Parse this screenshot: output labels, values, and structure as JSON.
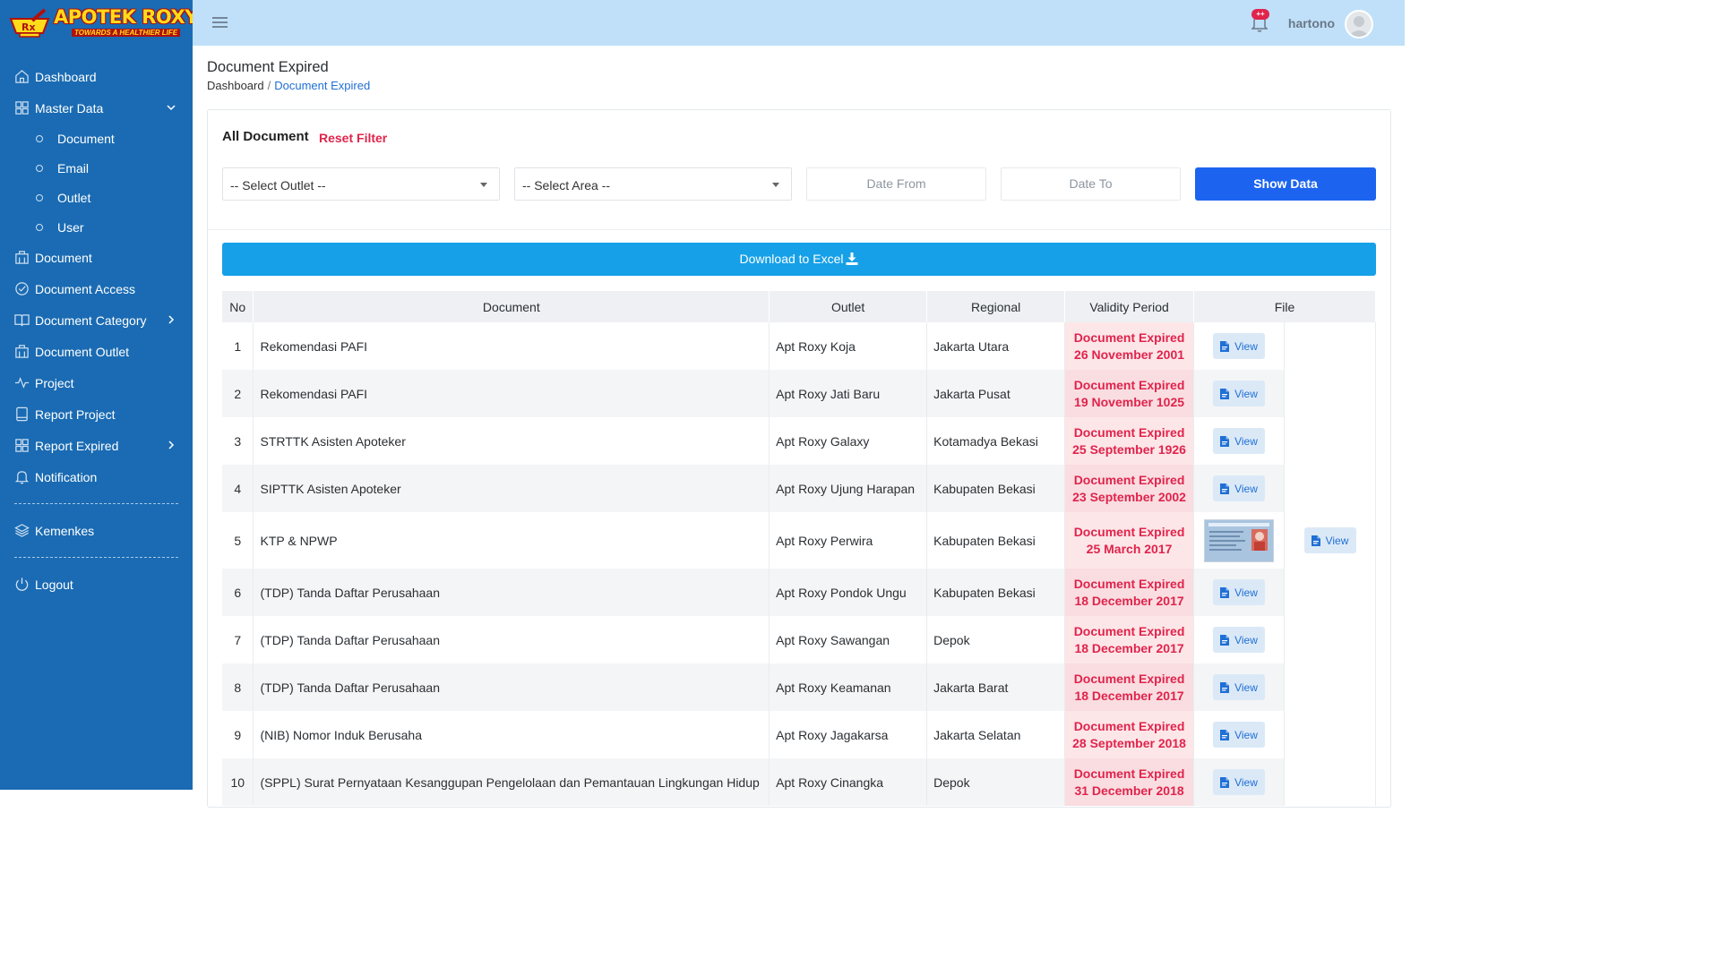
{
  "brand": {
    "name": "APOTEK ROXY",
    "tagline": "TOWARDS A HEALTHIER LIFE"
  },
  "sidebar": {
    "items": [
      {
        "label": "Dashboard",
        "icon": "home-icon"
      },
      {
        "label": "Master Data",
        "icon": "grid-icon",
        "expanded": true,
        "children": [
          {
            "label": "Document"
          },
          {
            "label": "Email"
          },
          {
            "label": "Outlet"
          },
          {
            "label": "User"
          }
        ]
      },
      {
        "label": "Document",
        "icon": "building-icon"
      },
      {
        "label": "Document Access",
        "icon": "check-circle-icon"
      },
      {
        "label": "Document Category",
        "icon": "book-icon",
        "has_children": true
      },
      {
        "label": "Document Outlet",
        "icon": "building-icon"
      },
      {
        "label": "Project",
        "icon": "activity-icon"
      },
      {
        "label": "Report Project",
        "icon": "tablet-icon"
      },
      {
        "label": "Report Expired",
        "icon": "grid-icon",
        "has_children": true
      },
      {
        "label": "Notification",
        "icon": "bell-icon"
      },
      {
        "label": "Kemenkes",
        "icon": "layers-icon"
      },
      {
        "label": "Logout",
        "icon": "power-icon"
      }
    ]
  },
  "topbar": {
    "username": "hartono",
    "notification_badge": "++"
  },
  "page": {
    "title": "Document Expired",
    "breadcrumb": [
      "Dashboard",
      "Document Expired"
    ]
  },
  "filters": {
    "title": "All Document",
    "reset_label": "Reset Filter",
    "outlet_select": "-- Select Outlet --",
    "area_select": "-- Select Area --",
    "date_from_placeholder": "Date From",
    "date_to_placeholder": "Date To",
    "show_button": "Show Data",
    "excel_button": "Download to Excel"
  },
  "table": {
    "columns": [
      "No",
      "Document",
      "Outlet",
      "Regional",
      "Validity Period",
      "File"
    ],
    "view_label": "View",
    "rows": [
      {
        "no": "1",
        "document": "Rekomendasi PAFI",
        "outlet": "Apt Roxy Koja",
        "regional": "Jakarta Utara",
        "status": "Document Expired",
        "date": "26 November 2001"
      },
      {
        "no": "2",
        "document": "Rekomendasi PAFI",
        "outlet": "Apt Roxy Jati Baru",
        "regional": "Jakarta Pusat",
        "status": "Document Expired",
        "date": "19 November 1025"
      },
      {
        "no": "3",
        "document": "STRTTK Asisten Apoteker",
        "outlet": "Apt Roxy Galaxy",
        "regional": "Kotamadya Bekasi",
        "status": "Document Expired",
        "date": "25 September 1926"
      },
      {
        "no": "4",
        "document": "SIPTTK Asisten Apoteker",
        "outlet": "Apt Roxy Ujung Harapan",
        "regional": "Kabupaten Bekasi",
        "status": "Document Expired",
        "date": "23 September 2002"
      },
      {
        "no": "5",
        "document": "KTP & NPWP",
        "outlet": "Apt Roxy Perwira",
        "regional": "Kabupaten Bekasi",
        "status": "Document Expired",
        "date": "25 March 2017",
        "has_thumbnail": true
      },
      {
        "no": "6",
        "document": "(TDP) Tanda Daftar Perusahaan",
        "outlet": "Apt Roxy Pondok Ungu",
        "regional": "Kabupaten Bekasi",
        "status": "Document Expired",
        "date": "18 December 2017"
      },
      {
        "no": "7",
        "document": "(TDP) Tanda Daftar Perusahaan",
        "outlet": "Apt Roxy Sawangan",
        "regional": "Depok",
        "status": "Document Expired",
        "date": "18 December 2017"
      },
      {
        "no": "8",
        "document": "(TDP) Tanda Daftar Perusahaan",
        "outlet": "Apt Roxy Keamanan",
        "regional": "Jakarta Barat",
        "status": "Document Expired",
        "date": "18 December 2017"
      },
      {
        "no": "9",
        "document": "(NIB) Nomor Induk Berusaha",
        "outlet": "Apt Roxy Jagakarsa",
        "regional": "Jakarta Selatan",
        "status": "Document Expired",
        "date": "28 September 2018"
      },
      {
        "no": "10",
        "document": "(SPPL) Surat Pernyataan Kesanggupan Pengelolaan dan Pemantauan Lingkungan Hidup",
        "outlet": "Apt Roxy Cinangka",
        "regional": "Depok",
        "status": "Document Expired",
        "date": "31 December 2018"
      }
    ]
  },
  "colors": {
    "sidebar": "#1a6bb3",
    "topbar": "#bfe0f8",
    "accent": "#1c64ef",
    "excel": "#16a0e8",
    "expired": "#e0244c"
  }
}
